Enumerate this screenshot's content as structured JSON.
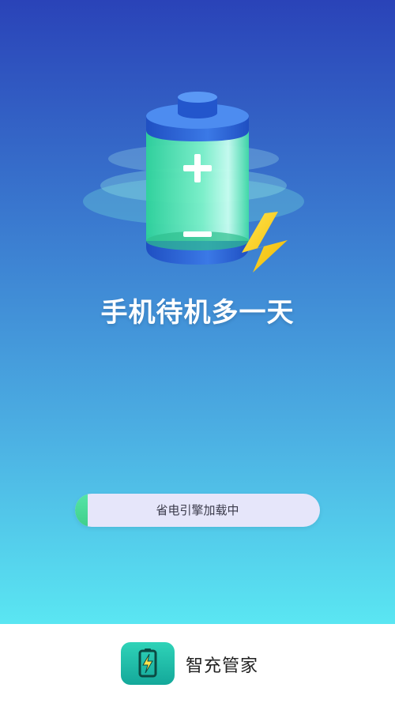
{
  "splash": {
    "tagline": "手机待机多一天",
    "icon": "battery-charging-illustration"
  },
  "loading": {
    "label": "省电引擎加载中",
    "progress_percent": 5,
    "fill_color": "#4fdc9a",
    "track_color": "#e6e6fa"
  },
  "footer": {
    "app_name": "智充管家",
    "logo_icon": "battery-bolt-icon"
  },
  "colors": {
    "background_top": "#2a43b8",
    "background_bottom": "#5ae6f2",
    "bolt": "#f7d21a",
    "battery_body": "#3ad9a4",
    "battery_cap": "#2e63d6"
  }
}
